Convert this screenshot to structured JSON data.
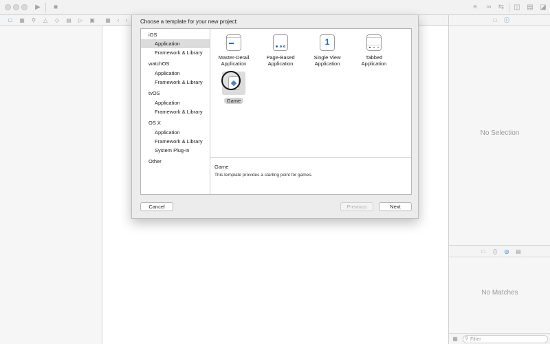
{
  "sheet": {
    "title": "Choose a template for your new project:",
    "categories": [
      {
        "label": "iOS"
      },
      {
        "label": "Application"
      },
      {
        "label": "Framework & Library"
      },
      {
        "label": "watchOS"
      },
      {
        "label": "Application"
      },
      {
        "label": "Framework & Library"
      },
      {
        "label": "tvOS"
      },
      {
        "label": "Application"
      },
      {
        "label": "Framework & Library"
      },
      {
        "label": "OS X"
      },
      {
        "label": "Application"
      },
      {
        "label": "Framework & Library"
      },
      {
        "label": "System Plug-in"
      },
      {
        "label": "Other"
      }
    ],
    "templates": [
      {
        "line1": "Master-Detail",
        "line2": "Application"
      },
      {
        "line1": "Page-Based",
        "line2": "Application"
      },
      {
        "line1": "Single View",
        "line2": "Application",
        "glyph": "1"
      },
      {
        "line1": "Tabbed",
        "line2": "Application"
      },
      {
        "line1": "Game"
      }
    ],
    "description": {
      "title": "Game",
      "text": "This template provides a starting point for games."
    },
    "buttons": {
      "cancel": "Cancel",
      "previous": "Previous",
      "next": "Next"
    }
  },
  "inspector": {
    "no_selection": "No Selection"
  },
  "library": {
    "no_matches": "No Matches",
    "filter_placeholder": "Filter"
  },
  "colors": {
    "accent": "#1a6fd1",
    "selection": "#dcdcdc"
  }
}
